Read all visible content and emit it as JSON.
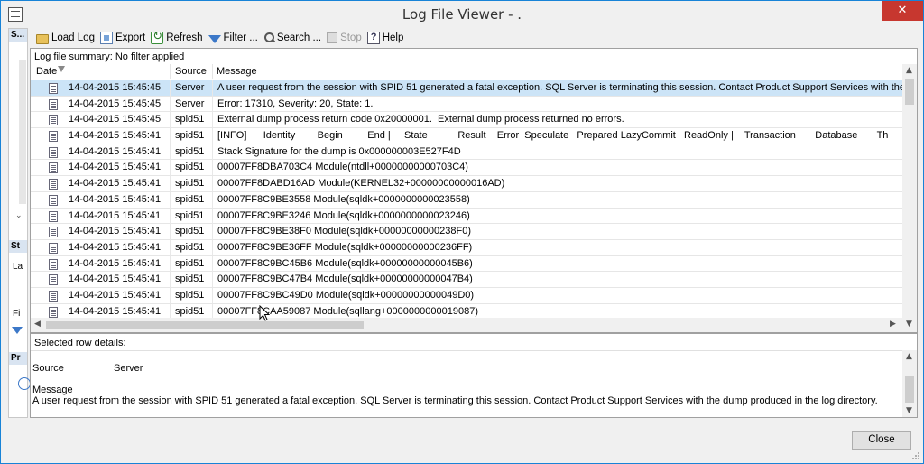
{
  "window": {
    "title": "Log File Viewer - .",
    "close_glyph": "✕"
  },
  "left_panel": {
    "items": [
      {
        "label": "S..."
      },
      {
        "label": "St"
      },
      {
        "label": "La"
      },
      {
        "label": "Fi"
      },
      {
        "label": "Pr"
      }
    ]
  },
  "toolbar": {
    "load_log": "Load Log",
    "export": "Export",
    "refresh": "Refresh",
    "filter": "Filter ...",
    "search": "Search ...",
    "stop": "Stop",
    "help": "Help"
  },
  "grid": {
    "summary": "Log file summary: No filter applied",
    "columns": {
      "date": "Date",
      "source": "Source",
      "message": "Message"
    },
    "rows": [
      {
        "date": "14-04-2015 15:45:45",
        "source": "Server",
        "message": "A user request from the session with SPID 51 generated a fatal exception. SQL Server is terminating this session. Contact Product Support Services with the dump produced"
      },
      {
        "date": "14-04-2015 15:45:45",
        "source": "Server",
        "message": "Error: 17310, Severity: 20, State: 1."
      },
      {
        "date": "14-04-2015 15:45:45",
        "source": "spid51",
        "message": "External dump process return code 0x20000001.  External dump process returned no errors."
      },
      {
        "date": "14-04-2015 15:45:41",
        "source": "spid51",
        "message": "[INFO]      Identity        Begin         End |     State           Result    Error  Speculate   Prepared LazyCommit   ReadOnly |    Transaction       Database       Th"
      },
      {
        "date": "14-04-2015 15:45:41",
        "source": "spid51",
        "message": "Stack Signature for the dump is 0x000000003E527F4D"
      },
      {
        "date": "14-04-2015 15:45:41",
        "source": "spid51",
        "message": "00007FF8DBA703C4 Module(ntdll+00000000000703C4)"
      },
      {
        "date": "14-04-2015 15:45:41",
        "source": "spid51",
        "message": "00007FF8DABD16AD Module(KERNEL32+00000000000016AD)"
      },
      {
        "date": "14-04-2015 15:45:41",
        "source": "spid51",
        "message": "00007FF8C9BE3558 Module(sqldk+0000000000023558)"
      },
      {
        "date": "14-04-2015 15:45:41",
        "source": "spid51",
        "message": "00007FF8C9BE3246 Module(sqldk+0000000000023246)"
      },
      {
        "date": "14-04-2015 15:45:41",
        "source": "spid51",
        "message": "00007FF8C9BE38F0 Module(sqldk+00000000000238F0)"
      },
      {
        "date": "14-04-2015 15:45:41",
        "source": "spid51",
        "message": "00007FF8C9BE36FF Module(sqldk+00000000000236FF)"
      },
      {
        "date": "14-04-2015 15:45:41",
        "source": "spid51",
        "message": "00007FF8C9BC45B6 Module(sqldk+00000000000045B6)"
      },
      {
        "date": "14-04-2015 15:45:41",
        "source": "spid51",
        "message": "00007FF8C9BC47B4 Module(sqldk+00000000000047B4)"
      },
      {
        "date": "14-04-2015 15:45:41",
        "source": "spid51",
        "message": "00007FF8C9BC49D0 Module(sqldk+00000000000049D0)"
      },
      {
        "date": "14-04-2015 15:45:41",
        "source": "spid51",
        "message": "00007FF8CAA59087 Module(sqllang+0000000000019087)"
      }
    ]
  },
  "details": {
    "title": "Selected row details:",
    "source_label": "Source",
    "source_value": "Server",
    "message_label": "Message",
    "message_value": "A user request from the session with SPID 51 generated a fatal exception. SQL Server is terminating this session. Contact Product Support Services with the dump produced in the log directory."
  },
  "buttons": {
    "close": "Close"
  },
  "colors": {
    "selected_row": "#cce4f7",
    "close_button_titlebar": "#c7372f",
    "window_border": "#1883d7"
  }
}
